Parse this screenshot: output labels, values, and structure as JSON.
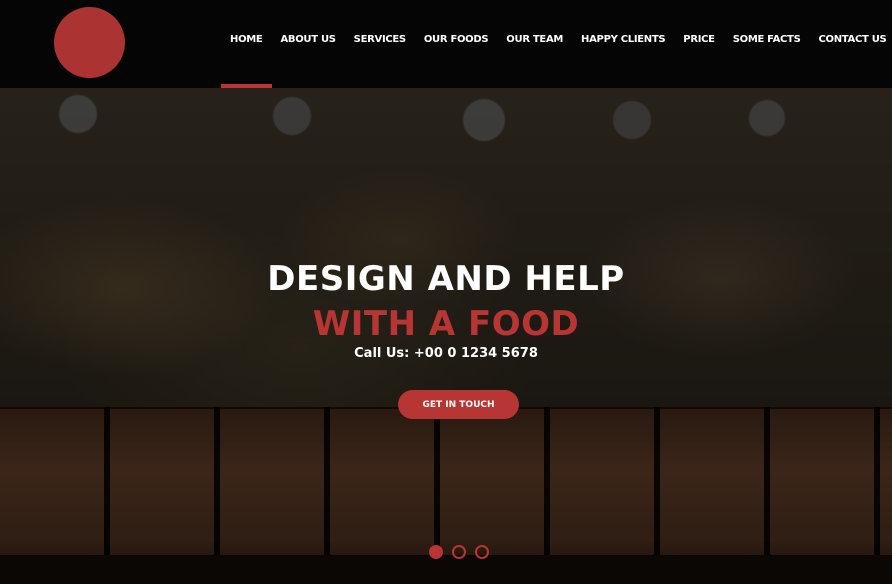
{
  "header": {
    "logo": "logo-circle",
    "nav": [
      {
        "label": "HOME",
        "active": true
      },
      {
        "label": "ABOUT US"
      },
      {
        "label": "SERVICES"
      },
      {
        "label": "OUR FOODS"
      },
      {
        "label": "OUR TEAM"
      },
      {
        "label": "HAPPY CLIENTS"
      },
      {
        "label": "PRICE"
      },
      {
        "label": "SOME FACTS"
      },
      {
        "label": "CONTACT US"
      }
    ]
  },
  "hero": {
    "headline_line1": "DESIGN AND HELP",
    "headline_line2": "WITH A FOOD",
    "call_text": "Call Us: +00 0 1234 5678",
    "cta_label": "GET IN TOUCH",
    "slides_total": 3,
    "active_slide": 1
  },
  "colors": {
    "accent": "#b73533",
    "logo": "#ab3432",
    "header_bg": "#050505"
  }
}
